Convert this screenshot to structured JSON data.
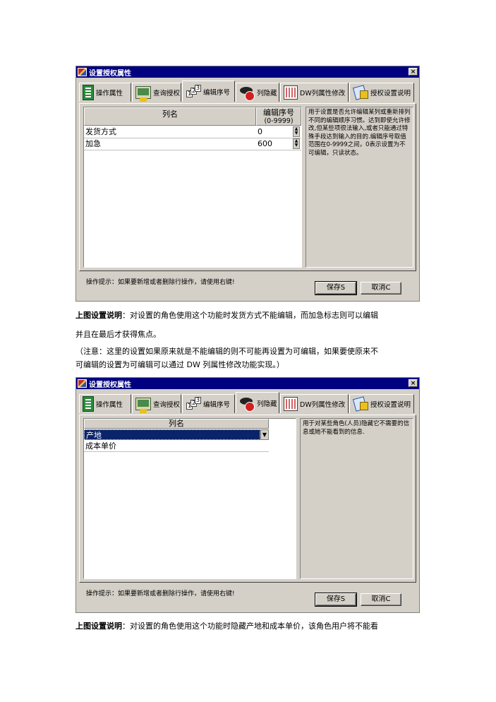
{
  "window1": {
    "title": "设置授权属性",
    "close": "×",
    "tabs": [
      "操作属性",
      "查询授权",
      "编辑序号",
      "列隐藏",
      "DW列属性修改",
      "授权设置说明"
    ],
    "columns": {
      "name": "列名",
      "seq": "编辑序号",
      "seq_range": "(0-9999)"
    },
    "rows": [
      {
        "name": "发货方式",
        "value": "0"
      },
      {
        "name": "加急",
        "value": "600"
      }
    ],
    "description": "用于设置是否允许编辑某列或重新排列不同的编辑顺序习惯。达到即使允许修改,但某些项很法输入,或者只能通过特殊手段达到输入的目的.编辑序号取值范围在0-9999之间，0表示设置为不可编辑，只读状态。",
    "tip": "操作提示：如果要新增或者删除行操作，请使用右键!",
    "save": "保存S",
    "cancel": "取消C"
  },
  "text1": {
    "label": "上图设置说明",
    "line1": "：对设置的角色使用这个功能时发货方式不能编辑，而加急标志则可以编辑",
    "line2": "并且在最后才获得焦点。",
    "line3": "（注意：这里的设置如果原来就是不能编辑的则不可能再设置为可编辑，如果要使原来不",
    "line4": "可编辑的设置为可编辑可以通过  DW 列属性修改功能实现。）"
  },
  "window2": {
    "title": "设置授权属性",
    "close": "×",
    "tabs": [
      "操作属性",
      "查询授权",
      "编辑序号",
      "列隐藏",
      "DW列属性修改",
      "授权设置说明"
    ],
    "column": "列名",
    "rows": [
      "产地",
      "成本单价"
    ],
    "description": "用于对某些角色(人员)隐藏它不需要的信息或她不能看到的信息.",
    "tip": "操作提示：如果要新增或者删除行操作，请使用右键!",
    "save": "保存S",
    "cancel": "取消C"
  },
  "text2": {
    "label": "上图设置说明",
    "line1": "：对设置的角色使用这个功能时隐藏产地和成本单价，该角色用户将不能看"
  }
}
